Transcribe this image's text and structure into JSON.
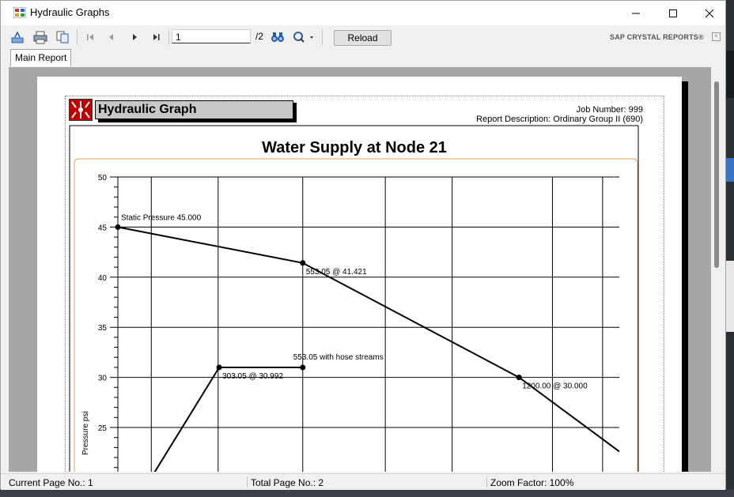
{
  "window": {
    "title": "Hydraulic Graphs"
  },
  "toolbar": {
    "page_value": "1",
    "page_total": "/2",
    "reload_label": "Reload",
    "brand": "SAP CRYSTAL REPORTS®"
  },
  "tabs": [
    {
      "label": "Main Report"
    }
  ],
  "report": {
    "title": "Hydraulic Graph",
    "job_number": "Job Number: 999",
    "description": "Report Description: Ordinary Group II (690)"
  },
  "status": {
    "current_page": "Current Page No.: 1",
    "total_pages": "Total Page No.: 2",
    "zoom": "Zoom Factor: 100%"
  },
  "chart_data": {
    "type": "line",
    "title": "Water Supply at Node 21",
    "ylabel": "Pressure  psi",
    "xlabel": "",
    "ylim": [
      20,
      50
    ],
    "yticks": [
      25,
      30,
      35,
      40,
      45,
      50
    ],
    "grid": true,
    "colors": {
      "line": "#000000",
      "frame": "#e6a15a"
    },
    "series": [
      {
        "points": [
          [
            0,
            45.0
          ],
          [
            553.05,
            41.421
          ],
          [
            1200.0,
            30.0
          ],
          [
            1500,
            22.6
          ]
        ]
      },
      {
        "points": [
          [
            100,
            20.0
          ],
          [
            303.05,
            30.992
          ],
          [
            553.05,
            30.992
          ]
        ]
      }
    ],
    "annotations": [
      {
        "text": "Static Pressure 45.000",
        "x": 0,
        "y": 45.0
      },
      {
        "text": "553.05 @ 41.421",
        "x": 553.05,
        "y": 41.421
      },
      {
        "text": "553.05 with hose streams",
        "x": 553.05,
        "y": 30.992
      },
      {
        "text": "303.05 @ 30.992",
        "x": 303.05,
        "y": 30.992
      },
      {
        "text": "1200.00 @ 30.000",
        "x": 1200.0,
        "y": 30.0
      }
    ]
  }
}
